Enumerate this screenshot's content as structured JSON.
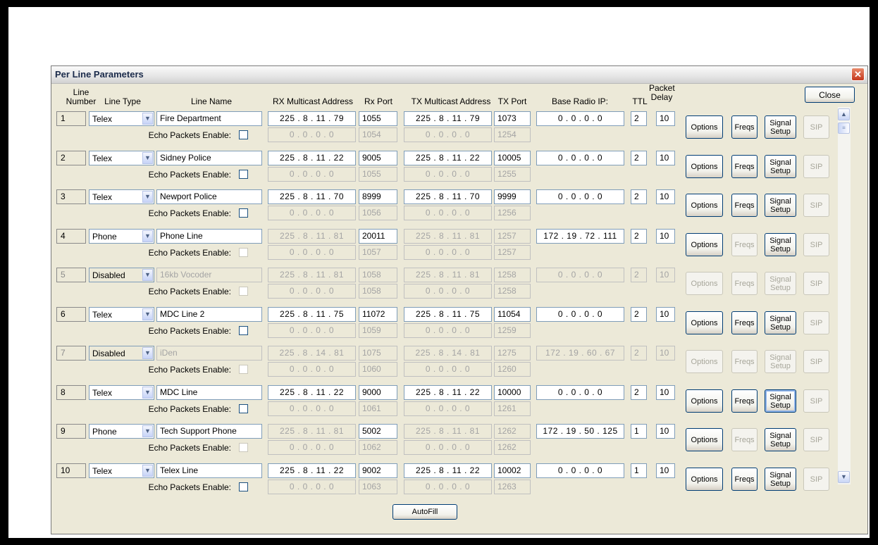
{
  "dialog": {
    "title": "Per Line Parameters",
    "close_label": "Close",
    "autofill_label": "AutoFill",
    "close_x": "✕"
  },
  "headers": {
    "line_number": "Line\nNumber",
    "line_type": "Line Type",
    "line_name": "Line Name",
    "rx_multicast": "RX Multicast Address",
    "rx_port": "Rx Port",
    "tx_multicast": "TX Multicast Address",
    "tx_port": "TX Port",
    "base_radio_ip": "Base Radio IP:",
    "ttl": "TTL",
    "packet_delay": "Packet\nDelay"
  },
  "labels": {
    "echo": "Echo Packets Enable:",
    "options": "Options",
    "freqs": "Freqs",
    "signal_setup": "Signal\nSetup",
    "sip": "SIP"
  },
  "icons": {
    "dropdown": "chevron-down-icon",
    "scroll_up": "chevron-up-icon",
    "scroll_down": "chevron-down-icon",
    "close": "close-icon"
  },
  "rows": [
    {
      "num": "1",
      "type": "Telex",
      "name": "Fire Department",
      "rx": "225 .  8  . 11 . 79",
      "rxport": "1055",
      "tx": "225 .  8  . 11 . 79",
      "txport": "1073",
      "base": "0  .  0  .  0  .  0",
      "ttl": "2",
      "delay": "10",
      "rx2": "0  .  0  .  0  .  0",
      "rxport2": "1054",
      "tx2": "0  .  0  .  0  .  0",
      "txport2": "1254",
      "enabled": true,
      "echo_enabled": true,
      "freqs_enabled": true,
      "rx_enabled": true,
      "base_enabled": true,
      "focus": false
    },
    {
      "num": "2",
      "type": "Telex",
      "name": "Sidney Police",
      "rx": "225 .  8  . 11 . 22",
      "rxport": "9005",
      "tx": "225 .  8  . 11 . 22",
      "txport": "10005",
      "base": "0  .  0  .  0  .  0",
      "ttl": "2",
      "delay": "10",
      "rx2": "0  .  0  .  0  .  0",
      "rxport2": "1055",
      "tx2": "0  .  0  .  0  .  0",
      "txport2": "1255",
      "enabled": true,
      "echo_enabled": true,
      "freqs_enabled": true,
      "rx_enabled": true,
      "base_enabled": true,
      "focus": false
    },
    {
      "num": "3",
      "type": "Telex",
      "name": "Newport Police",
      "rx": "225 .  8  . 11 . 70",
      "rxport": "8999",
      "tx": "225 .  8  . 11 . 70",
      "txport": "9999",
      "base": "0  .  0  .  0  .  0",
      "ttl": "2",
      "delay": "10",
      "rx2": "0  .  0  .  0  .  0",
      "rxport2": "1056",
      "tx2": "0  .  0  .  0  .  0",
      "txport2": "1256",
      "enabled": true,
      "echo_enabled": true,
      "freqs_enabled": true,
      "rx_enabled": true,
      "base_enabled": true,
      "focus": false
    },
    {
      "num": "4",
      "type": "Phone",
      "name": "Phone Line",
      "rx": "225 .  8  . 11 . 81",
      "rxport": "20011",
      "tx": "225 .  8  . 11 . 81",
      "txport": "1257",
      "base": "172 . 19 . 72 . 111",
      "ttl": "2",
      "delay": "10",
      "rx2": "0  .  0  .  0  .  0",
      "rxport2": "1057",
      "tx2": "0  .  0  .  0  .  0",
      "txport2": "1257",
      "enabled": true,
      "echo_enabled": false,
      "freqs_enabled": false,
      "rx_enabled": false,
      "base_enabled": true,
      "focus": false
    },
    {
      "num": "5",
      "type": "Disabled",
      "name": "16kb Vocoder",
      "rx": "225 .  8  . 11 . 81",
      "rxport": "1058",
      "tx": "225 .  8  . 11 . 81",
      "txport": "1258",
      "base": "0  .  0  .  0  .  0",
      "ttl": "2",
      "delay": "10",
      "rx2": "0  .  0  .  0  .  0",
      "rxport2": "1058",
      "tx2": "0  .  0  .  0  .  0",
      "txport2": "1258",
      "enabled": false,
      "echo_enabled": false,
      "freqs_enabled": false,
      "rx_enabled": false,
      "base_enabled": false,
      "focus": false
    },
    {
      "num": "6",
      "type": "Telex",
      "name": "MDC Line 2",
      "rx": "225 .  8  . 11 . 75",
      "rxport": "11072",
      "tx": "225 .  8  . 11 . 75",
      "txport": "11054",
      "base": "0  .  0  .  0  .  0",
      "ttl": "2",
      "delay": "10",
      "rx2": "0  .  0  .  0  .  0",
      "rxport2": "1059",
      "tx2": "0  .  0  .  0  .  0",
      "txport2": "1259",
      "enabled": true,
      "echo_enabled": true,
      "freqs_enabled": true,
      "rx_enabled": true,
      "base_enabled": true,
      "focus": false
    },
    {
      "num": "7",
      "type": "Disabled",
      "name": "iDen",
      "rx": "225 .  8  . 14 . 81",
      "rxport": "1075",
      "tx": "225 .  8  . 14 . 81",
      "txport": "1275",
      "base": "172 . 19 . 60 . 67",
      "ttl": "2",
      "delay": "10",
      "rx2": "0  .  0  .  0  .  0",
      "rxport2": "1060",
      "tx2": "0  .  0  .  0  .  0",
      "txport2": "1260",
      "enabled": false,
      "echo_enabled": false,
      "freqs_enabled": false,
      "rx_enabled": false,
      "base_enabled": false,
      "focus": false
    },
    {
      "num": "8",
      "type": "Telex",
      "name": "MDC Line",
      "rx": "225 .  8  . 11 . 22",
      "rxport": "9000",
      "tx": "225 .  8  . 11 . 22",
      "txport": "10000",
      "base": "0  .  0  .  0  .  0",
      "ttl": "2",
      "delay": "10",
      "rx2": "0  .  0  .  0  .  0",
      "rxport2": "1061",
      "tx2": "0  .  0  .  0  .  0",
      "txport2": "1261",
      "enabled": true,
      "echo_enabled": true,
      "freqs_enabled": true,
      "rx_enabled": true,
      "base_enabled": true,
      "focus": true
    },
    {
      "num": "9",
      "type": "Phone",
      "name": "Tech Support Phone",
      "rx": "225 .  8  . 11 . 81",
      "rxport": "5002",
      "tx": "225 .  8  . 11 . 81",
      "txport": "1262",
      "base": "172 . 19 . 50 . 125",
      "ttl": "1",
      "delay": "10",
      "rx2": "0  .  0  .  0  .  0",
      "rxport2": "1062",
      "tx2": "0  .  0  .  0  .  0",
      "txport2": "1262",
      "enabled": true,
      "echo_enabled": false,
      "freqs_enabled": false,
      "rx_enabled": false,
      "base_enabled": true,
      "focus": false
    },
    {
      "num": "10",
      "type": "Telex",
      "name": "Telex Line",
      "rx": "225 .  8  . 11 . 22",
      "rxport": "9002",
      "tx": "225 .  8  . 11 . 22",
      "txport": "10002",
      "base": "0  .  0  .  0  .  0",
      "ttl": "1",
      "delay": "10",
      "rx2": "0  .  0  .  0  .  0",
      "rxport2": "1063",
      "tx2": "0  .  0  .  0  .  0",
      "txport2": "1263",
      "enabled": true,
      "echo_enabled": true,
      "freqs_enabled": true,
      "rx_enabled": true,
      "base_enabled": true,
      "focus": false
    }
  ]
}
